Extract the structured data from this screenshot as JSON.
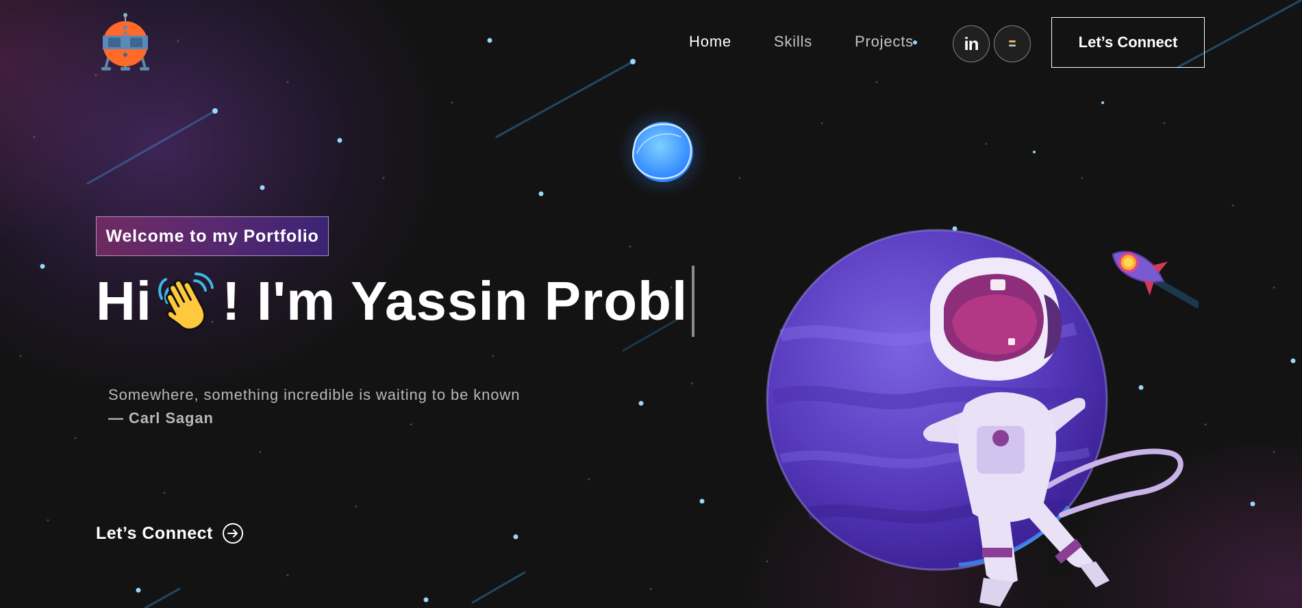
{
  "nav": {
    "links": [
      {
        "label": "Home",
        "active": true
      },
      {
        "label": "Skills",
        "active": false
      },
      {
        "label": "Projects",
        "active": false
      }
    ],
    "social": [
      {
        "icon": "linkedin-icon",
        "glyph": "in"
      },
      {
        "icon": "social-icon"
      }
    ],
    "cta_label": "Let’s Connect"
  },
  "hero": {
    "tagline": "Welcome to my Portfolio",
    "greeting_prefix": "Hi",
    "greeting_emoji": "waving-hand-icon",
    "greeting_suffix": "! I'm Yassin Probl",
    "quote_text": "Somewhere, something incredible is waiting to be known",
    "quote_author": "— Carl Sagan",
    "cta_label": "Let’s Connect"
  },
  "theme": {
    "background": "#131313",
    "accent_pink": "#AA367C",
    "accent_purple": "#4A2FBD",
    "text": "#FFFFFF",
    "muted_text": "#B9B9B9"
  }
}
